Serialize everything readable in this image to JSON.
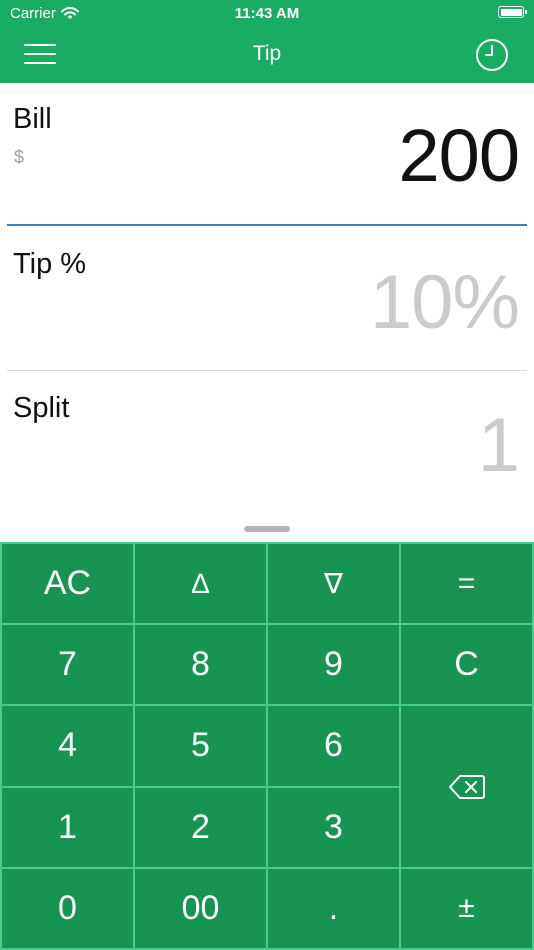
{
  "status_bar": {
    "carrier": "Carrier",
    "time": "11:43 AM"
  },
  "nav": {
    "title": "Tip",
    "menu_icon": "hamburger-menu-icon",
    "history_icon": "clock-icon"
  },
  "bill": {
    "label": "Bill",
    "currency": "$",
    "value": "200"
  },
  "tip": {
    "label": "Tip %",
    "value": "10%"
  },
  "split": {
    "label": "Split",
    "value": "1"
  },
  "keypad": {
    "all_clear": "AC",
    "increment": "∆",
    "decrement": "∇",
    "equals": "=",
    "seven": "7",
    "eight": "8",
    "nine": "9",
    "clear": "C",
    "four": "4",
    "five": "5",
    "six": "6",
    "one": "1",
    "two": "2",
    "three": "3",
    "zero": "0",
    "double_zero": "00",
    "decimal": ".",
    "plus_minus": "±",
    "backspace_icon": "backspace-icon"
  },
  "colors": {
    "brand_green": "#19ad62",
    "key_green": "#17944f",
    "key_grid": "#47cc8a",
    "focus_blue": "#3b7fc8"
  }
}
